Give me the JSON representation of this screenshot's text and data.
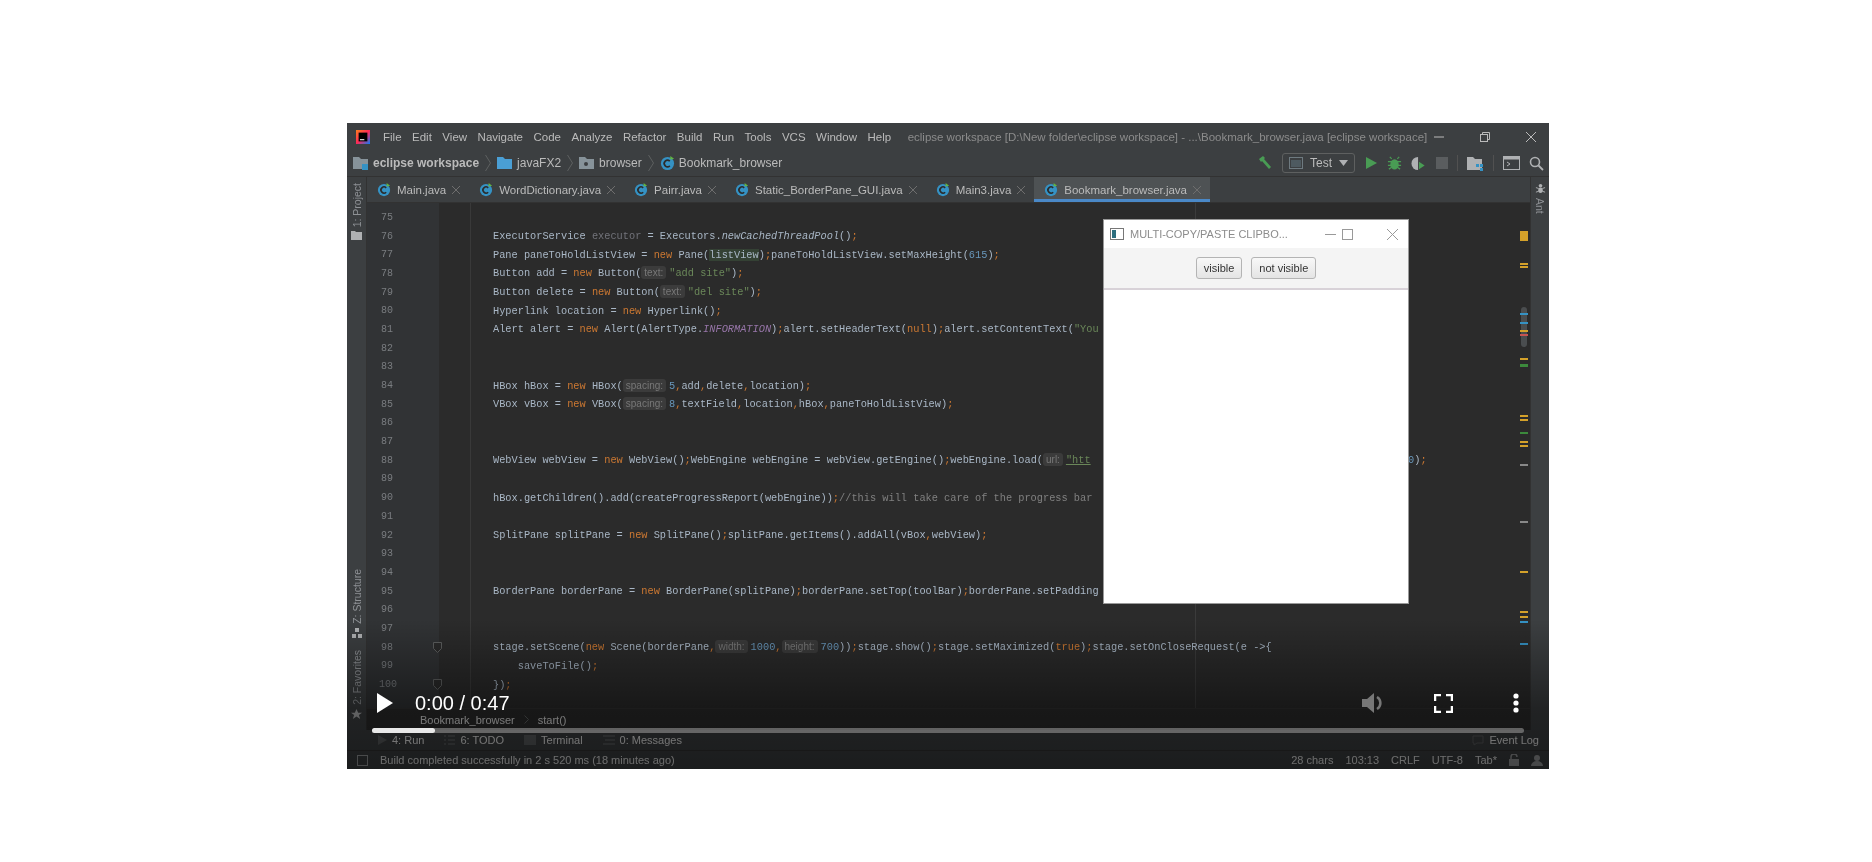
{
  "window": {
    "title": "eclipse workspace [D:\\New folder\\eclipse workspace] - ...\\Bookmark_browser.java [eclipse workspace]"
  },
  "menu": [
    "File",
    "Edit",
    "View",
    "Navigate",
    "Code",
    "Analyze",
    "Refactor",
    "Build",
    "Run",
    "Tools",
    "VCS",
    "Window",
    "Help"
  ],
  "breadcrumb": [
    {
      "label": "eclipse workspace",
      "kind": "project"
    },
    {
      "label": "javaFX2",
      "kind": "folder"
    },
    {
      "label": "browser",
      "kind": "package"
    },
    {
      "label": "Bookmark_browser",
      "kind": "class"
    }
  ],
  "run_config": {
    "label": "Test"
  },
  "tool_windows_left": [
    {
      "label": "1: Project",
      "kind": "project"
    },
    {
      "label": "Z: Structure",
      "kind": "structure"
    },
    {
      "label": "2: Favorites",
      "kind": "favorites"
    }
  ],
  "tool_windows_right": [
    {
      "label": "Ant"
    }
  ],
  "tabs": [
    {
      "label": "Main.java",
      "selected": false
    },
    {
      "label": "WordDictionary.java",
      "selected": false
    },
    {
      "label": "Pairr.java",
      "selected": false
    },
    {
      "label": "Static_BorderPane_GUI.java",
      "selected": false
    },
    {
      "label": "Main3.java",
      "selected": false
    },
    {
      "label": "Bookmark_browser.java",
      "selected": true
    }
  ],
  "editor": {
    "lines": [
      {
        "number": "75",
        "fold": false
      },
      {
        "number": "76",
        "fold": false,
        "tokens": [
          {
            "kind": "plain",
            "text": "ExecutorService "
          },
          {
            "kind": "unused",
            "text": "executor"
          },
          {
            "kind": "plain",
            "text": " = Executors."
          },
          {
            "kind": "italic",
            "text": "newCachedThreadPool"
          },
          {
            "kind": "plain",
            "text": "()"
          },
          {
            "kind": "punct",
            "text": ";"
          }
        ]
      },
      {
        "number": "77",
        "fold": false,
        "tokens": [
          {
            "kind": "plain",
            "text": "Pane paneToHoldListView = "
          },
          {
            "kind": "keyword",
            "text": "new"
          },
          {
            "kind": "plain",
            "text": " Pane("
          },
          {
            "kind": "highlight",
            "text": "listView"
          },
          {
            "kind": "plain",
            "text": ")"
          },
          {
            "kind": "punct",
            "text": ";"
          },
          {
            "kind": "plain",
            "text": "paneToHoldListView.setMaxHeight("
          },
          {
            "kind": "number",
            "text": "615"
          },
          {
            "kind": "plain",
            "text": ")"
          },
          {
            "kind": "punct",
            "text": ";"
          }
        ]
      },
      {
        "number": "78",
        "fold": false,
        "tokens": [
          {
            "kind": "plain",
            "text": "Button add = "
          },
          {
            "kind": "keyword",
            "text": "new"
          },
          {
            "kind": "plain",
            "text": " Button("
          },
          {
            "kind": "hint",
            "text": "text:"
          },
          {
            "kind": "string",
            "text": "\"add site\""
          },
          {
            "kind": "plain",
            "text": ")"
          },
          {
            "kind": "punct",
            "text": ";"
          }
        ]
      },
      {
        "number": "79",
        "fold": false,
        "tokens": [
          {
            "kind": "plain",
            "text": "Button delete = "
          },
          {
            "kind": "keyword",
            "text": "new"
          },
          {
            "kind": "plain",
            "text": " Button("
          },
          {
            "kind": "hint",
            "text": "text:"
          },
          {
            "kind": "string",
            "text": "\"del site\""
          },
          {
            "kind": "plain",
            "text": ")"
          },
          {
            "kind": "punct",
            "text": ";"
          }
        ]
      },
      {
        "number": "80",
        "fold": false,
        "tokens": [
          {
            "kind": "plain",
            "text": "Hyperlink location = "
          },
          {
            "kind": "keyword",
            "text": "new"
          },
          {
            "kind": "plain",
            "text": " Hyperlink()"
          },
          {
            "kind": "punct",
            "text": ";"
          }
        ]
      },
      {
        "number": "81",
        "fold": false,
        "tokens": [
          {
            "kind": "plain",
            "text": "Alert alert = "
          },
          {
            "kind": "keyword",
            "text": "new"
          },
          {
            "kind": "plain",
            "text": " Alert(AlertType."
          },
          {
            "kind": "constant",
            "text": "INFORMATION"
          },
          {
            "kind": "plain",
            "text": ")"
          },
          {
            "kind": "punct",
            "text": ";"
          },
          {
            "kind": "plain",
            "text": "alert.setHeaderText("
          },
          {
            "kind": "keyword",
            "text": "null"
          },
          {
            "kind": "plain",
            "text": ")"
          },
          {
            "kind": "punct",
            "text": ";"
          },
          {
            "kind": "plain",
            "text": "alert.setContentText("
          },
          {
            "kind": "string",
            "text": "\"You"
          }
        ]
      },
      {
        "number": "82",
        "fold": false
      },
      {
        "number": "83",
        "fold": false
      },
      {
        "number": "84",
        "fold": false,
        "tokens": [
          {
            "kind": "plain",
            "text": "HBox hBox = "
          },
          {
            "kind": "keyword",
            "text": "new"
          },
          {
            "kind": "plain",
            "text": " HBox("
          },
          {
            "kind": "hint",
            "text": "spacing:"
          },
          {
            "kind": "number",
            "text": "5"
          },
          {
            "kind": "punct",
            "text": ","
          },
          {
            "kind": "plain",
            "text": "add"
          },
          {
            "kind": "punct",
            "text": ","
          },
          {
            "kind": "plain",
            "text": "delete"
          },
          {
            "kind": "punct",
            "text": ","
          },
          {
            "kind": "plain",
            "text": "location)"
          },
          {
            "kind": "punct",
            "text": ";"
          }
        ]
      },
      {
        "number": "85",
        "fold": false,
        "tokens": [
          {
            "kind": "plain",
            "text": "VBox vBox = "
          },
          {
            "kind": "keyword",
            "text": "new"
          },
          {
            "kind": "plain",
            "text": " VBox("
          },
          {
            "kind": "hint",
            "text": "spacing:"
          },
          {
            "kind": "number",
            "text": "8"
          },
          {
            "kind": "punct",
            "text": ","
          },
          {
            "kind": "plain",
            "text": "textField"
          },
          {
            "kind": "punct",
            "text": ","
          },
          {
            "kind": "plain",
            "text": "location"
          },
          {
            "kind": "punct",
            "text": ","
          },
          {
            "kind": "plain",
            "text": "hBox"
          },
          {
            "kind": "punct",
            "text": ","
          },
          {
            "kind": "plain",
            "text": "paneToHoldListView)"
          },
          {
            "kind": "punct",
            "text": ";"
          }
        ]
      },
      {
        "number": "86",
        "fold": false
      },
      {
        "number": "87",
        "fold": false
      },
      {
        "number": "88",
        "fold": false,
        "tokens": [
          {
            "kind": "plain",
            "text": "WebView webView = "
          },
          {
            "kind": "keyword",
            "text": "new"
          },
          {
            "kind": "plain",
            "text": " WebView()"
          },
          {
            "kind": "punct",
            "text": ";"
          },
          {
            "kind": "plain",
            "text": "WebEngine webEngine = webView.getEngine()"
          },
          {
            "kind": "punct",
            "text": ";"
          },
          {
            "kind": "plain",
            "text": "webEngine.load("
          },
          {
            "kind": "hint",
            "text": "url:"
          },
          {
            "kind": "link",
            "text": "\"htt"
          }
        ],
        "tail": [
          {
            "kind": "number",
            "text": "0"
          },
          {
            "kind": "plain",
            "text": ")"
          },
          {
            "kind": "punct",
            "text": ";"
          }
        ]
      },
      {
        "number": "89",
        "fold": false
      },
      {
        "number": "90",
        "fold": false,
        "tokens": [
          {
            "kind": "plain",
            "text": "hBox.getChildren().add(createProgressReport(webEngine))"
          },
          {
            "kind": "punct",
            "text": ";"
          },
          {
            "kind": "comment",
            "text": "//this will take care of the progress bar"
          }
        ]
      },
      {
        "number": "91",
        "fold": false
      },
      {
        "number": "92",
        "fold": false,
        "tokens": [
          {
            "kind": "plain",
            "text": "SplitPane splitPane = "
          },
          {
            "kind": "keyword",
            "text": "new"
          },
          {
            "kind": "plain",
            "text": " SplitPane()"
          },
          {
            "kind": "punct",
            "text": ";"
          },
          {
            "kind": "plain",
            "text": "splitPane.getItems().addAll(vBox"
          },
          {
            "kind": "punct",
            "text": ","
          },
          {
            "kind": "plain",
            "text": "webView)"
          },
          {
            "kind": "punct",
            "text": ";"
          }
        ]
      },
      {
        "number": "93",
        "fold": false
      },
      {
        "number": "94",
        "fold": false
      },
      {
        "number": "95",
        "fold": false,
        "tokens": [
          {
            "kind": "plain",
            "text": "BorderPane borderPane = "
          },
          {
            "kind": "keyword",
            "text": "new"
          },
          {
            "kind": "plain",
            "text": " BorderPane(splitPane)"
          },
          {
            "kind": "punct",
            "text": ";"
          },
          {
            "kind": "plain",
            "text": "borderPane.setTop(toolBar)"
          },
          {
            "kind": "punct",
            "text": ";"
          },
          {
            "kind": "plain",
            "text": "borderPane.setPadding"
          }
        ]
      },
      {
        "number": "96",
        "fold": false
      },
      {
        "number": "97",
        "fold": false
      },
      {
        "number": "98",
        "fold": true,
        "tokens": [
          {
            "kind": "plain",
            "text": "stage.setScene("
          },
          {
            "kind": "keyword",
            "text": "new"
          },
          {
            "kind": "plain",
            "text": " Scene(borderPane"
          },
          {
            "kind": "punct",
            "text": ","
          },
          {
            "kind": "hint",
            "text": "width:"
          },
          {
            "kind": "number",
            "text": "1000"
          },
          {
            "kind": "punct",
            "text": ","
          },
          {
            "kind": "hint",
            "text": "height:"
          },
          {
            "kind": "number",
            "text": "700"
          },
          {
            "kind": "plain",
            "text": "))"
          },
          {
            "kind": "punct",
            "text": ";"
          },
          {
            "kind": "plain",
            "text": "stage.show()"
          },
          {
            "kind": "punct",
            "text": ";"
          },
          {
            "kind": "plain",
            "text": "stage.setMaximized("
          },
          {
            "kind": "keyword",
            "text": "true"
          },
          {
            "kind": "plain",
            "text": ")"
          },
          {
            "kind": "punct",
            "text": ";"
          },
          {
            "kind": "plain",
            "text": "stage.setOnCloseRequest(e ->{"
          }
        ]
      },
      {
        "number": "99",
        "fold": false,
        "tokens": [
          {
            "kind": "plain",
            "text": "    saveToFile()"
          },
          {
            "kind": "punct",
            "text": ";"
          }
        ]
      },
      {
        "number": "100",
        "fold": true,
        "tokens": [
          {
            "kind": "plain",
            "text": "})"
          },
          {
            "kind": "punct",
            "text": ";"
          }
        ]
      }
    ]
  },
  "popup": {
    "title": "MULTI-COPY/PASTE CLIPBO...",
    "buttons": [
      "visible",
      "not visible"
    ]
  },
  "code_breadcrumb": [
    "Bookmark_browser",
    "start()"
  ],
  "bottom_tabs": [
    {
      "label": "4: Run",
      "kind": "run"
    },
    {
      "label": "6: TODO",
      "kind": "todo"
    },
    {
      "label": "Terminal",
      "kind": "terminal"
    },
    {
      "label": "0: Messages",
      "kind": "messages"
    }
  ],
  "event_log": {
    "label": "Event Log"
  },
  "status_bar": {
    "message": "Build completed successfully in 2 s 520 ms (18 minutes ago)",
    "items": [
      "28 chars",
      "103:13",
      "CRLF",
      "UTF-8",
      "Tab*"
    ]
  },
  "video": {
    "time": "0:00 / 0:47",
    "playing": false,
    "level": 0.055
  }
}
